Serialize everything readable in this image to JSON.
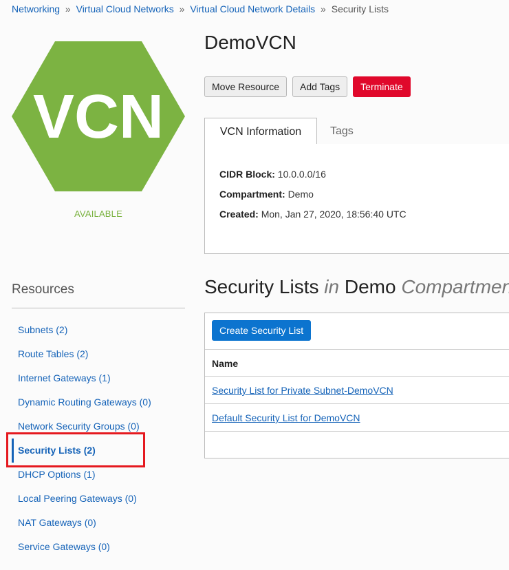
{
  "breadcrumb": {
    "items": [
      "Networking",
      "Virtual Cloud Networks",
      "Virtual Cloud Network Details"
    ],
    "separator": "»",
    "current": "Security Lists"
  },
  "logo": {
    "text": "VCN",
    "color": "#7cb342",
    "text_color": "#ffffff",
    "icon": "vcn-hexagon-icon"
  },
  "status": {
    "text": "AVAILABLE",
    "color": "#7cb342"
  },
  "page": {
    "title": "DemoVCN"
  },
  "actions": {
    "move": "Move Resource",
    "add_tags": "Add Tags",
    "terminate": "Terminate",
    "terminate_color": "#e0082b"
  },
  "tabs": {
    "info": "VCN Information",
    "tags": "Tags"
  },
  "info": {
    "cidr_label": "CIDR Block:",
    "cidr_value": "10.0.0.0/16",
    "compartment_label": "Compartment:",
    "compartment_value": "Demo",
    "created_label": "Created:",
    "created_value": "Mon, Jan 27, 2020, 18:56:40 UTC"
  },
  "resources": {
    "heading": "Resources",
    "items": [
      {
        "label": "Subnets (2)"
      },
      {
        "label": "Route Tables (2)"
      },
      {
        "label": "Internet Gateways (1)"
      },
      {
        "label": "Dynamic Routing Gateways (0)"
      },
      {
        "label": "Network Security Groups (0)"
      },
      {
        "label": "Security Lists (2)",
        "active": true
      },
      {
        "label": "DHCP Options (1)"
      },
      {
        "label": "Local Peering Gateways (0)"
      },
      {
        "label": "NAT Gateways (0)"
      },
      {
        "label": "Service Gateways (0)"
      }
    ],
    "highlight_color": "#e5191f"
  },
  "security": {
    "title": "Security Lists",
    "in": "in",
    "compartment": "Demo",
    "compartment_suffix": "Compartmen",
    "create_button": "Create Security List",
    "name_header": "Name",
    "rows": [
      "Security List for Private Subnet-DemoVCN",
      "Default Security List for DemoVCN"
    ],
    "link_color": "#1563b8",
    "primary_color": "#0c74cf"
  }
}
